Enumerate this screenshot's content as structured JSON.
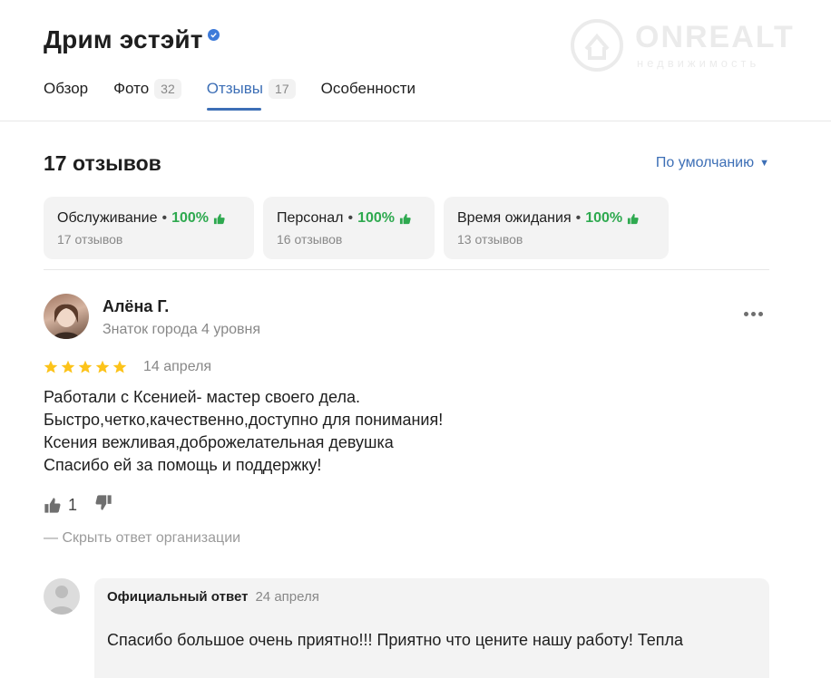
{
  "org": {
    "name": "Дрим эстэйт"
  },
  "watermark": {
    "main": "ONREALT",
    "sub": "недвижимость"
  },
  "tabs": [
    {
      "label": "Обзор",
      "count": ""
    },
    {
      "label": "Фото",
      "count": "32"
    },
    {
      "label": "Отзывы",
      "count": "17"
    },
    {
      "label": "Особенности",
      "count": ""
    }
  ],
  "reviews_header": {
    "title": "17 отзывов",
    "sort_label": "По умолчанию"
  },
  "aspects": [
    {
      "name": "Обслуживание",
      "percent": "100%",
      "count": "17 отзывов"
    },
    {
      "name": "Персонал",
      "percent": "100%",
      "count": "16 отзывов"
    },
    {
      "name": "Время ожидания",
      "percent": "100%",
      "count": "13 отзывов"
    }
  ],
  "review": {
    "author": "Алёна Г.",
    "level": "Знаток города 4 уровня",
    "rating": 5,
    "date": "14 апреля",
    "lines": [
      "Работали с Ксенией- мастер своего дела.",
      "Быстро,четко,качественно,доступно для понимания!",
      "Ксения вежливая,доброжелательная девушка",
      "Спасибо ей за помощь и поддержку!"
    ],
    "likes": "1",
    "hide_answer_label": "— Скрыть ответ организации"
  },
  "answer": {
    "label": "Официальный ответ",
    "date": "24 апреля",
    "text": "Спасибо большое очень приятно!!! Приятно что цените нашу работу! Тепла"
  },
  "colors": {
    "accent": "#3d6fb6",
    "positive": "#2ea94f",
    "star": "#fcc31a",
    "verified": "#3e7bd9"
  }
}
